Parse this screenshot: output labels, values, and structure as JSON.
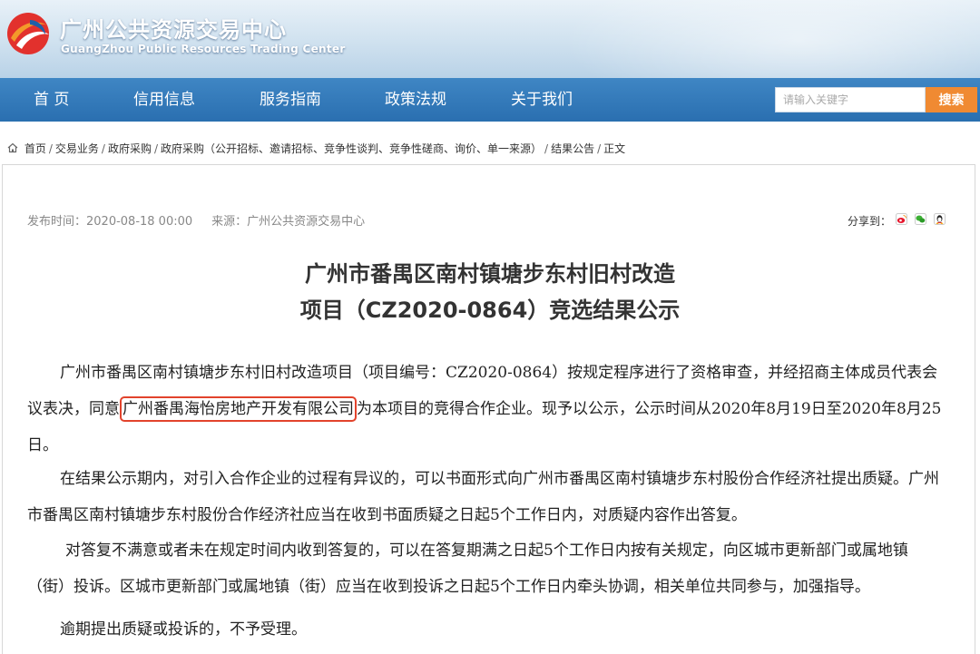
{
  "header": {
    "title": "广州公共资源交易中心",
    "subtitle": "GuangZhou Public Resources Trading Center",
    "logo_icon": "globe-swoosh-logo",
    "colors": {
      "logo_red": "#e2312d",
      "logo_orange": "#f39a2a",
      "logo_blue": "#1f5fa8"
    }
  },
  "nav": {
    "items": [
      {
        "label": "首 页"
      },
      {
        "label": "信用信息"
      },
      {
        "label": "服务指南"
      },
      {
        "label": "政策法规"
      },
      {
        "label": "关于我们"
      }
    ],
    "search_placeholder": "请输入关键字",
    "search_button": "搜索",
    "colors": {
      "bar": "#2f79ba",
      "search_button": "#f08a32"
    }
  },
  "breadcrumb": {
    "home_icon": "home-icon",
    "items": [
      "首页",
      "交易业务",
      "政府采购",
      "政府采购（公开招标、邀请招标、竞争性谈判、竞争性磋商、询价、单一来源）",
      "结果公告",
      "正文"
    ]
  },
  "article": {
    "publish_time": "发布时间：2020-08-18 00:00",
    "source": "来源：广州公共资源交易中心",
    "share_label": "分享到：",
    "share_icons": [
      "weibo-icon",
      "wechat-icon",
      "qq-icon"
    ],
    "title_line1": "广州市番禺区南村镇塘步东村旧村改造",
    "title_line2": "项目（CZ2020-0864）竞选结果公示",
    "p1_before": "广州市番禺区南村镇塘步东村旧村改造项目（项目编号：CZ2020-0864）按规定程序进行了资格审查，并经招商主体成员代表会议表决，同意",
    "p1_highlight": "广州番禺海怡房地产开发有限公司",
    "p1_after": "为本项目的竞得合作企业。现予以公示，公示时间从2020年8月19日至2020年8月25日。",
    "p2": "在结果公示期内，对引入合作企业的过程有异议的，可以书面形式向广州市番禺区南村镇塘步东村股份合作经济社提出质疑。广州市番禺区南村镇塘步东村股份合作经济社应当在收到书面质疑之日起5个工作日内，对质疑内容作出答复。",
    "p3": "对答复不满意或者未在规定时间内收到答复的，可以在答复期满之日起5个工作日内按有关规定，向区城市更新部门或属地镇（街）投诉。区城市更新部门或属地镇（街）应当在收到投诉之日起5个工作日内牵头协调，相关单位共同参与，加强指导。",
    "p4": "逾期提出质疑或投诉的，不予受理。",
    "highlight_color": "#e2432c"
  }
}
